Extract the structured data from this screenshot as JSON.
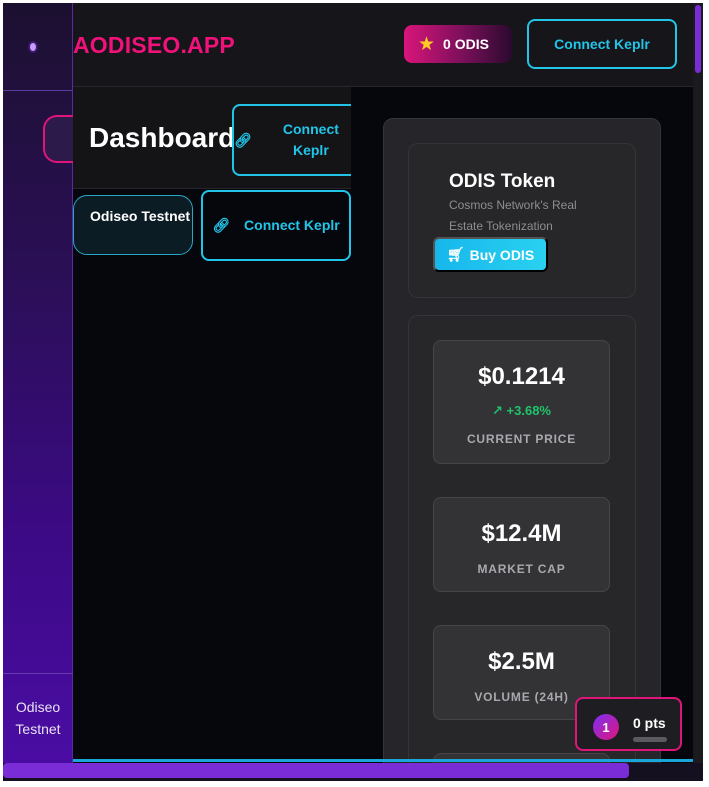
{
  "header": {
    "brand": "AODISEO.APP",
    "odis_balance": "0 ODIS",
    "connect_label": "Connect Keplr"
  },
  "sidebar": {
    "network": "Odiseo Testnet"
  },
  "dashboard": {
    "title": "Dashboard",
    "connect_label": "Connect Keplr",
    "network_pill": "Odiseo Testnet",
    "connect_label_2": "Connect Keplr"
  },
  "token": {
    "name": "ODIS Token",
    "description": "Cosmos Network's Real Estate Tokenization",
    "buy_label": "Buy ODIS"
  },
  "stats": [
    {
      "value": "$0.1214",
      "change": "+3.68%",
      "label": "CURRENT PRICE"
    },
    {
      "value": "$12.4M",
      "label": "MARKET CAP"
    },
    {
      "value": "$2.5M",
      "label": "VOLUME (24H)"
    }
  ],
  "points": {
    "rank": "1",
    "label": "0 pts"
  },
  "colors": {
    "accent_pink": "#f0127a",
    "accent_cyan": "#22c5e8",
    "positive_green": "#1fc46a",
    "sidebar_purple": "#4a0ca3"
  }
}
